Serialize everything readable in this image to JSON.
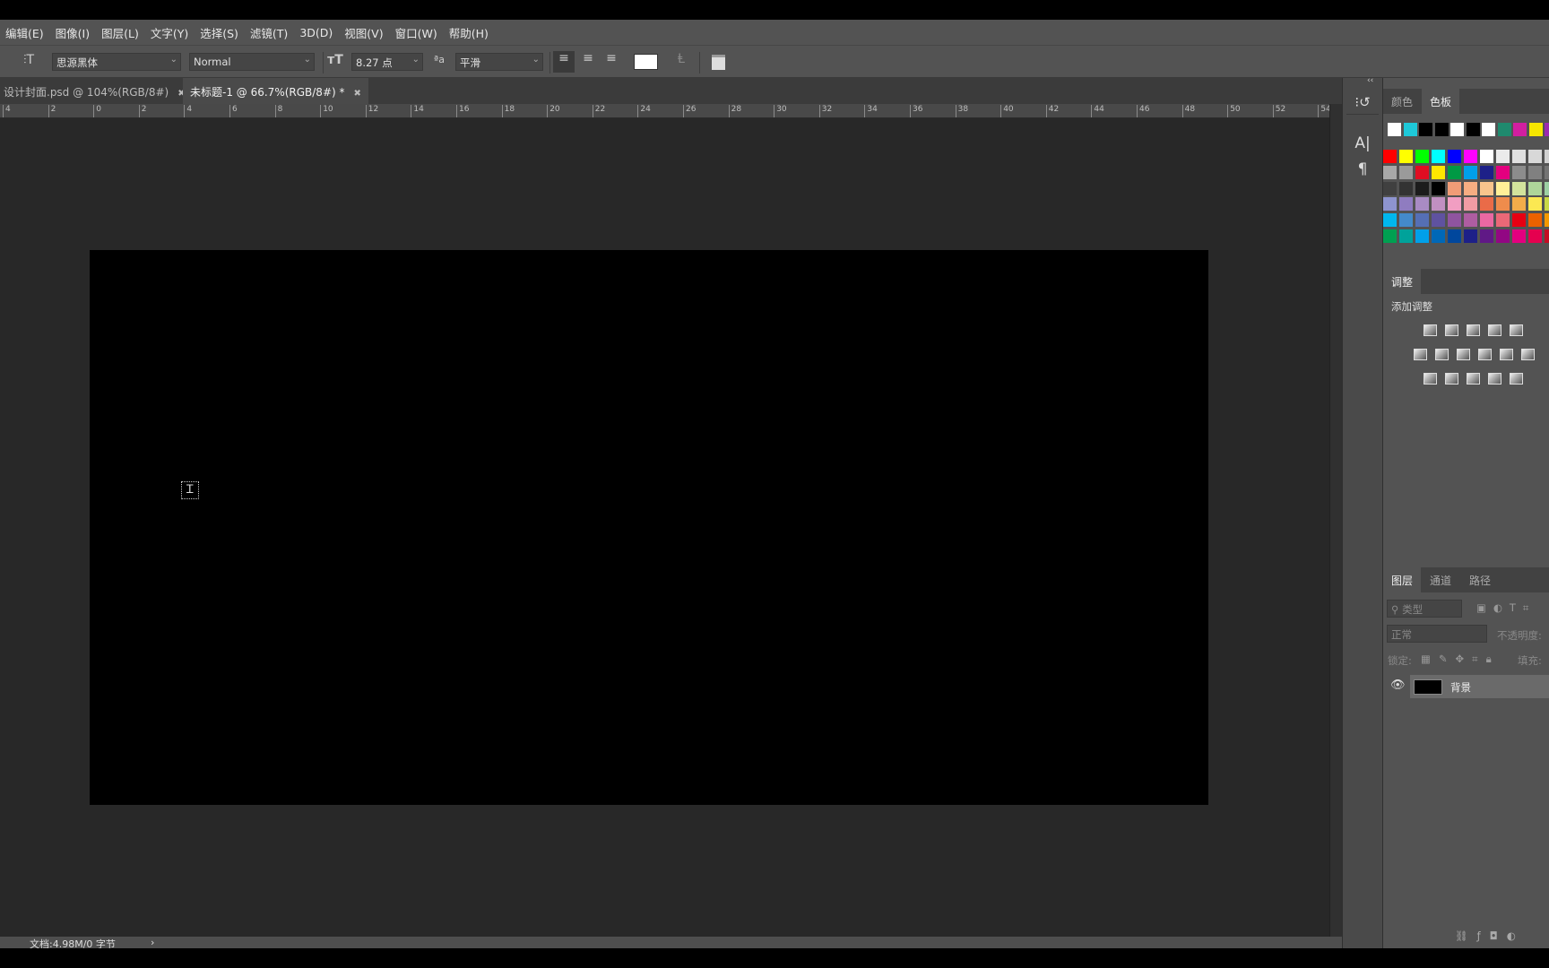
{
  "menu": [
    "编辑(E)",
    "图像(I)",
    "图层(L)",
    "文字(Y)",
    "选择(S)",
    "滤镜(T)",
    "3D(D)",
    "视图(V)",
    "窗口(W)",
    "帮助(H)"
  ],
  "options": {
    "font_family": "思源黑体",
    "font_style": "Normal",
    "font_size": "8.27 点",
    "antialias": "平滑",
    "text_color": "#ffffff"
  },
  "tabs": [
    {
      "label": "设计封面.psd @ 104%(RGB/8#)",
      "active": false
    },
    {
      "label": "未标题-1 @ 66.7%(RGB/8#) *",
      "active": true
    }
  ],
  "ruler_labels": [
    "4",
    "2",
    "0",
    "2",
    "4",
    "6",
    "8",
    "10",
    "12",
    "14",
    "16",
    "18",
    "20",
    "22",
    "24",
    "26",
    "28",
    "30",
    "32",
    "34",
    "36",
    "38",
    "40",
    "42",
    "44",
    "46",
    "48",
    "50",
    "52",
    "54"
  ],
  "status": {
    "doc_info": "文档:4.98M/0 字节",
    "arrow": "›"
  },
  "swatches_panel": {
    "tabs": [
      "颜色",
      "色板"
    ],
    "active": "色板",
    "recent": [
      "#ffffff",
      "#1ec8d8",
      "#000000",
      "#000000",
      "#ffffff",
      "#000000",
      "#ffffff",
      "#1f8a6e",
      "#d21fa0",
      "#f5e600",
      "#9a2ab0"
    ],
    "grid": [
      [
        "#ff0000",
        "#ffff00",
        "#00ff00",
        "#00ffff",
        "#0000ff",
        "#ff00ff",
        "#ffffff",
        "#ebebeb",
        "#e0e0e0",
        "#d8d8d8",
        "#d0d0d0"
      ],
      [
        "#a8a8a8",
        "#9a9a9a",
        "#e00d22",
        "#ffe600",
        "#009944",
        "#00a0e9",
        "#1d2088",
        "#e4007f",
        "#8c8c8c",
        "#808080",
        "#747474"
      ],
      [
        "#404040",
        "#333333",
        "#1c1c1c",
        "#000000",
        "#f19c77",
        "#f6ad82",
        "#f8c58c",
        "#fff097",
        "#d3e39c",
        "#aed69a",
        "#9cd0a4"
      ],
      [
        "#8e94cf",
        "#8f7cc0",
        "#a98bc3",
        "#c190c2",
        "#f19ec2",
        "#f09ca4",
        "#ea6b48",
        "#ef8c4c",
        "#f3ac4a",
        "#fbe852",
        "#c9d846"
      ],
      [
        "#00b7ee",
        "#448aca",
        "#556fb5",
        "#5f52a0",
        "#8f54a0",
        "#ae5da1",
        "#ea68a2",
        "#eb6877",
        "#e60012",
        "#eb6100",
        "#f39800"
      ],
      [
        "#00a051",
        "#00a29a",
        "#00a0e9",
        "#0068b7",
        "#00479d",
        "#1d2088",
        "#601986",
        "#920783",
        "#e4007f",
        "#e5004f",
        "#c30d23"
      ]
    ]
  },
  "adjustments_panel": {
    "tab": "调整",
    "heading": "添加调整"
  },
  "layers_panel": {
    "tabs": [
      "图层",
      "通道",
      "路径"
    ],
    "filter_placeholder": "类型",
    "blend_mode": "正常",
    "opacity_label": "不透明度:",
    "lock_label": "锁定:",
    "fill_label": "填充:",
    "layers": [
      {
        "name": "背景",
        "visible": true
      }
    ]
  }
}
